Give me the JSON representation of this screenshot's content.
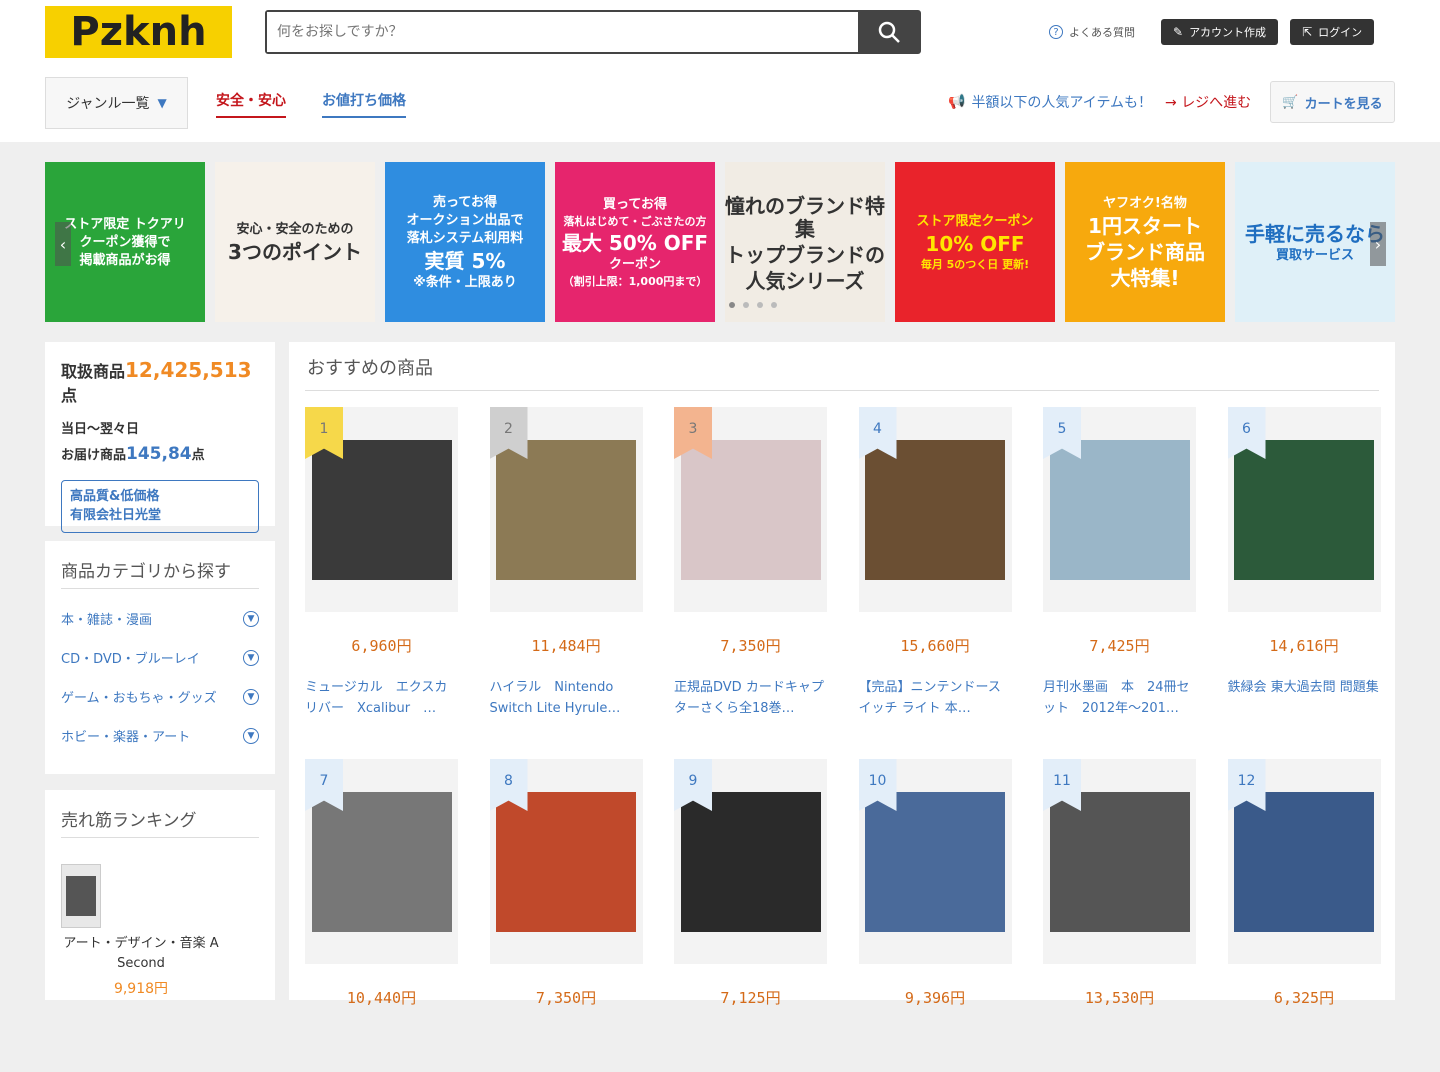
{
  "header": {
    "logo": "Pzknh",
    "search_placeholder": "何をお探しですか？",
    "faq": "よくある質問",
    "create_account": "アカウント作成",
    "login": "ログイン",
    "genre": "ジャンル一覧",
    "tab_safe": "安全・安心",
    "tab_deal": "お値打ち価格",
    "promo": "半額以下の人気アイテムも！",
    "checkout": "レジへ進む",
    "cart": "カートを見る"
  },
  "banners": [
    {
      "lines": [
        "ストア限定 トクアリ",
        "クーポン獲得で",
        "掲載商品がお得"
      ],
      "bg": "#2aa53a",
      "color": "#ffffff"
    },
    {
      "lines": [
        "安心・安全のための",
        "3つのポイント"
      ],
      "bg": "#f6f1ea",
      "color": "#333333"
    },
    {
      "lines": [
        "売ってお得",
        "オークション出品で",
        "落札システム利用料",
        "実質 5%",
        "※条件・上限あり"
      ],
      "bg": "#2f8de0",
      "color": "#ffffff"
    },
    {
      "lines": [
        "買ってお得",
        "落札はじめて・ごぶさたの方",
        "最大 50% OFF",
        "クーポン",
        "（割引上限：1,000円まで）"
      ],
      "bg": "#e6256d",
      "color": "#ffffff"
    },
    {
      "lines": [
        "憧れのブランド特集",
        "トップブランドの",
        "人気シリーズ"
      ],
      "bg": "#f1ece4",
      "color": "#333333"
    },
    {
      "lines": [
        "ストア限定クーポン",
        "10% OFF",
        "毎月 5のつく日 更新!"
      ],
      "bg": "#e9232b",
      "color": "#ffe600"
    },
    {
      "lines": [
        "ヤフオク!名物",
        "1円スタート",
        "ブランド商品",
        "大特集!"
      ],
      "bg": "#f7a90d",
      "color": "#ffffff"
    },
    {
      "lines": [
        "手軽に売るなら",
        "買取サービス"
      ],
      "bg": "#dff0f8",
      "color": "#1f6ec0"
    }
  ],
  "stats": {
    "total_label": "取扱商品",
    "total_value": "12,425,513",
    "total_unit": "点",
    "delivery_label1": "当日〜翌々日",
    "delivery_label2": "お届け商品",
    "delivery_value": "145,84",
    "delivery_unit": "点",
    "shop_line1": "高品質&低価格",
    "shop_line2": "有限会社日光堂"
  },
  "categories": {
    "title": "商品カテゴリから探す",
    "items": [
      "本・雑誌・漫画",
      "CD・DVD・ブルーレイ",
      "ゲーム・おもちゃ・グッズ",
      "ホビー・楽器・アート"
    ]
  },
  "ranking": {
    "title": "売れ筋ランキング",
    "item_title": "アート・デザイン・音楽 A Second",
    "item_price": "9,918円"
  },
  "recommend": {
    "title": "おすすめの商品",
    "items": [
      {
        "rank": "1",
        "price": "6,960円",
        "title": "ミュージカル　エクスカリバー　Xcalibur　…",
        "tag": "#f6d84a",
        "img": "#3a3a3a"
      },
      {
        "rank": "2",
        "price": "11,484円",
        "title": "ハイラル　Nintendo Switch Lite Hyrule…",
        "tag": "#cfcfcf",
        "img": "#8c7a55"
      },
      {
        "rank": "3",
        "price": "7,350円",
        "title": "正規品DVD カードキャプターさくら全18巻…",
        "tag": "#f3b48f",
        "img": "#d9c6c8"
      },
      {
        "rank": "4",
        "price": "15,660円",
        "title": "【完品】ニンテンドースイッチ ライト 本…",
        "tag": "#e3eef9",
        "img": "#6b4f33"
      },
      {
        "rank": "5",
        "price": "7,425円",
        "title": "月刊水墨画　本　24冊セット　2012年〜201…",
        "tag": "#e3eef9",
        "img": "#9ab6c8"
      },
      {
        "rank": "6",
        "price": "14,616円",
        "title": "鉄緑会 東大過去問 問題集",
        "tag": "#e3eef9",
        "img": "#2c5a3a"
      },
      {
        "rank": "7",
        "price": "10,440円",
        "title": "",
        "tag": "#e3eef9",
        "img": "#777777"
      },
      {
        "rank": "8",
        "price": "7,350円",
        "title": "",
        "tag": "#e3eef9",
        "img": "#c0492b"
      },
      {
        "rank": "9",
        "price": "7,125円",
        "title": "",
        "tag": "#e3eef9",
        "img": "#2a2a2a"
      },
      {
        "rank": "10",
        "price": "9,396円",
        "title": "",
        "tag": "#e3eef9",
        "img": "#4a6a9a"
      },
      {
        "rank": "11",
        "price": "13,530円",
        "title": "",
        "tag": "#e3eef9",
        "img": "#555555"
      },
      {
        "rank": "12",
        "price": "6,325円",
        "title": "",
        "tag": "#e3eef9",
        "img": "#3a5a8a"
      }
    ]
  }
}
